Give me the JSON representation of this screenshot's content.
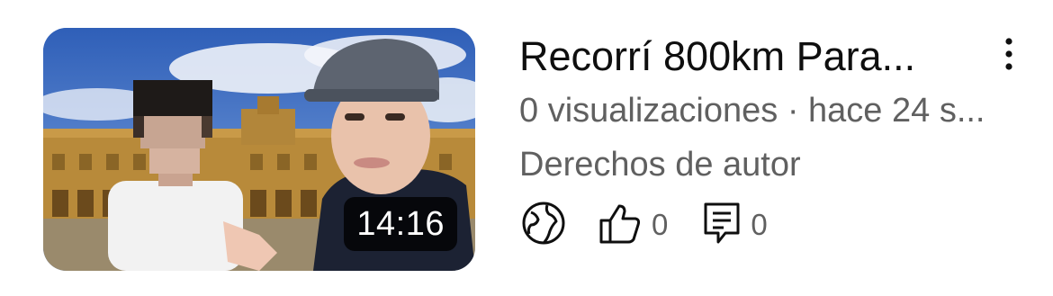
{
  "video": {
    "title": "Recorrí 800km Para...",
    "meta": "0 visualizaciones · hace 24 s...",
    "status": "Derechos de autor",
    "duration": "14:16",
    "likes": "0",
    "comments": "0"
  },
  "icons": {
    "visibility": "globe-icon",
    "likes": "thumbs-up-icon",
    "comments": "comment-icon",
    "menu": "more-vert-icon"
  },
  "colors": {
    "text_primary": "#0f0f0f",
    "text_secondary": "#606060",
    "duration_bg": "#000000"
  }
}
